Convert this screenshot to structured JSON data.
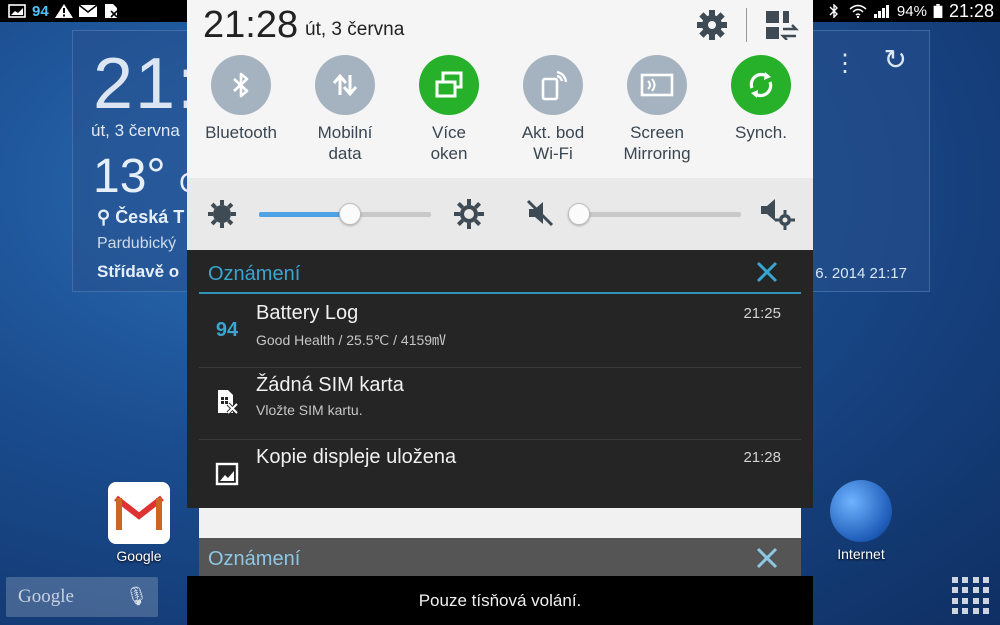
{
  "statusbar": {
    "battery_log_level": "94",
    "battery_percent": "94%",
    "time": "21:28"
  },
  "home_widget": {
    "time": "21:",
    "date": "út, 3 června",
    "temperature": "13°",
    "temperature_unit": "C",
    "location": "Česká T",
    "region": "Pardubický",
    "weather": "Střídavě o",
    "updated": "6. 2014 21:17"
  },
  "home_apps": {
    "google_label": "Google",
    "internet_label": "Internet",
    "search_placeholder": "Google"
  },
  "quick_settings": {
    "time": "21:28",
    "date": "út, 3 června",
    "toggles": [
      {
        "label_line1": "Bluetooth",
        "label_line2": "",
        "icon": "bluetooth-icon",
        "active": false
      },
      {
        "label_line1": "Mobilní",
        "label_line2": "data",
        "icon": "mobile-data-icon",
        "active": false
      },
      {
        "label_line1": "Více",
        "label_line2": "oken",
        "icon": "multi-window-icon",
        "active": true
      },
      {
        "label_line1": "Akt. bod",
        "label_line2": "Wi-Fi",
        "icon": "hotspot-icon",
        "active": false
      },
      {
        "label_line1": "Screen",
        "label_line2": "Mirroring",
        "icon": "screen-mirroring-icon",
        "active": false
      },
      {
        "label_line1": "Synch.",
        "label_line2": "",
        "icon": "sync-icon",
        "active": true
      }
    ],
    "brightness_level": 0.53,
    "volume_level": 0.0
  },
  "notifications": {
    "header": "Oznámení",
    "items": [
      {
        "icon": "battery-log-icon",
        "icon_text": "94",
        "title": "Battery Log",
        "text": "Good Health / 25.5℃ / 4159㎷",
        "time": "21:25"
      },
      {
        "icon": "no-sim-icon",
        "title": "Žádná SIM karta",
        "text": "Vložte SIM kartu.",
        "time": ""
      },
      {
        "icon": "screenshot-icon",
        "title": "Kopie displeje uložena",
        "text": "",
        "time": "21:28"
      }
    ],
    "ghost_header": "Oznámení"
  },
  "emergency_text": "Pouze tísňová volání.",
  "colors": {
    "accent": "#39a6cf",
    "toggle_on": "#27b12b",
    "toggle_off": "#a5b3c0",
    "slider_fill": "#4da3e6"
  }
}
